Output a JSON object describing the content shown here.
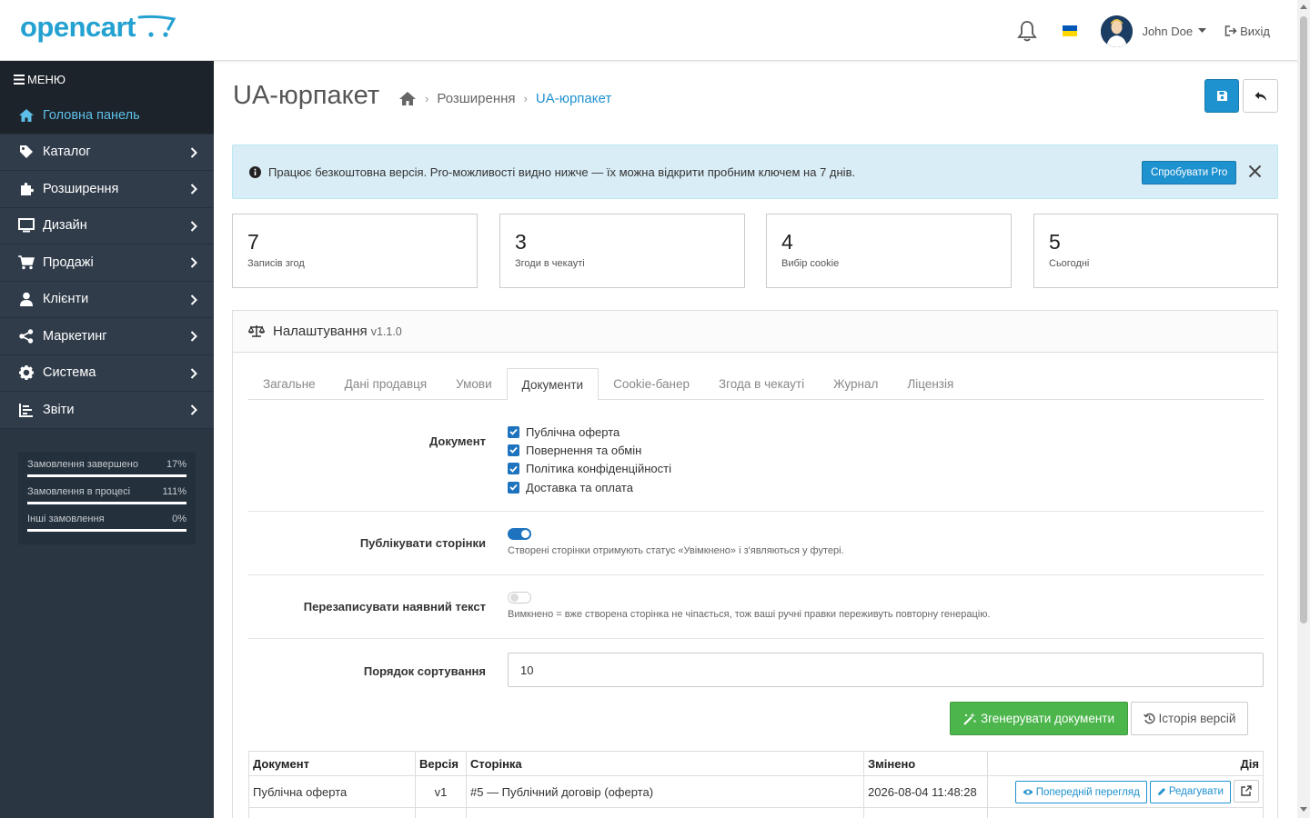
{
  "header": {
    "logo_text": "opencart",
    "user_name": "John Doe",
    "logout_label": "Вихід",
    "flag_colors": [
      "#0057b7",
      "#ffd700"
    ]
  },
  "sidebar": {
    "menu_label": "МЕНЮ",
    "items": [
      {
        "label": "Головна панель",
        "icon": "home-icon",
        "active": true
      },
      {
        "label": "Каталог",
        "icon": "tag-icon"
      },
      {
        "label": "Розширення",
        "icon": "puzzle-icon"
      },
      {
        "label": "Дизайн",
        "icon": "desktop-icon"
      },
      {
        "label": "Продажі",
        "icon": "cart-icon"
      },
      {
        "label": "Клієнти",
        "icon": "user-icon"
      },
      {
        "label": "Маркетинг",
        "icon": "share-icon"
      },
      {
        "label": "Система",
        "icon": "gear-icon"
      },
      {
        "label": "Звіти",
        "icon": "chart-icon"
      }
    ],
    "stats": [
      {
        "label": "Замовлення завершено",
        "value": "17%"
      },
      {
        "label": "Замовлення в процесі",
        "value": "111%"
      },
      {
        "label": "Інші замовлення",
        "value": "0%"
      }
    ]
  },
  "page": {
    "title": "UA-юрпакет",
    "breadcrumbs": [
      "Розширення",
      "UA-юрпакет"
    ]
  },
  "alert": {
    "text": "Працює безкоштовна версія. Pro-можливості видно нижче — їх можна відкрити пробним ключем на 7 днів.",
    "button": "Спробувати Pro"
  },
  "cards": [
    {
      "value": "7",
      "label": "Записів згод"
    },
    {
      "value": "3",
      "label": "Згоди в чекауті"
    },
    {
      "value": "4",
      "label": "Вибір cookie"
    },
    {
      "value": "5",
      "label": "Сьогодні"
    }
  ],
  "panel": {
    "title": "Налаштування",
    "version": "v1.1.0",
    "tabs": [
      "Загальне",
      "Дані продавця",
      "Умови",
      "Документи",
      "Cookie-банер",
      "Згода в чекауті",
      "Журнал",
      "Ліцензія"
    ],
    "active_tab": 3,
    "fields": {
      "documents_label": "Документ",
      "documents": [
        "Публічна оферта",
        "Повернення та обмін",
        "Політика конфіденційності",
        "Доставка та оплата"
      ],
      "publish_label": "Публікувати сторінки",
      "publish_help": "Створені сторінки отримують статус «Увімкнено» і з'являються у футері.",
      "overwrite_label": "Перезаписувати наявний текст",
      "overwrite_help": "Вимкнено = вже створена сторінка не чіпається, тож ваші ручні правки переживуть повторну генерацію.",
      "sort_label": "Порядок сортування",
      "sort_value": "10"
    },
    "buttons": {
      "generate": "Згенерувати документи",
      "history": "Історія версій"
    },
    "table": {
      "headers": [
        "Документ",
        "Версія",
        "Сторінка",
        "Змінено",
        "Дія"
      ],
      "rows": [
        {
          "doc": "Публічна оферта",
          "version": "v1",
          "page": "#5 — Публічний договір (оферта)",
          "changed": "2026-08-04 11:48:28"
        }
      ],
      "preview_label": "Попередній перегляд",
      "edit_label": "Редагувати"
    }
  }
}
